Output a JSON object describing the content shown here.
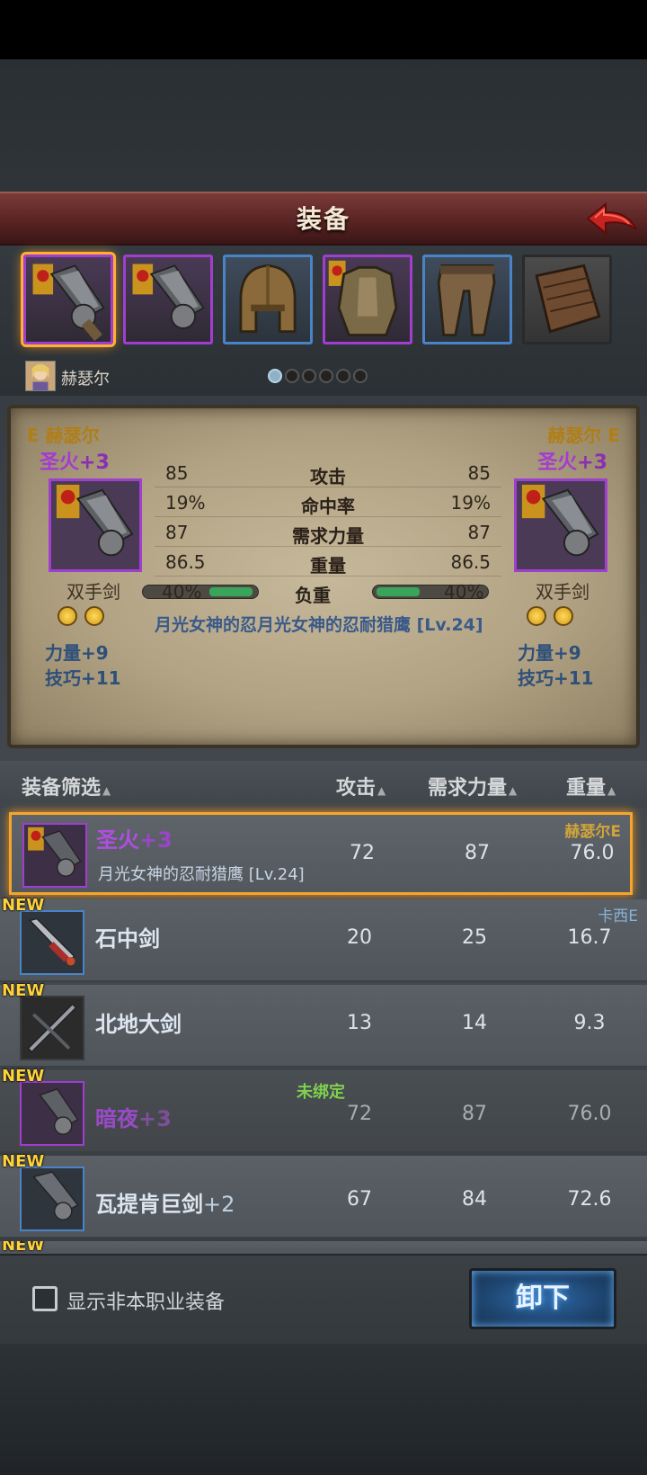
{
  "header": {
    "title": "装备"
  },
  "hero": {
    "name": "赫瑟尔"
  },
  "slots": [
    {
      "icon": "greatsword-icon",
      "rarity": "purple",
      "selected": true
    },
    {
      "icon": "greatsword-icon",
      "rarity": "purple"
    },
    {
      "icon": "helmet-icon",
      "rarity": "blue"
    },
    {
      "icon": "armor-icon",
      "rarity": "purple"
    },
    {
      "icon": "pants-icon",
      "rarity": "blue"
    },
    {
      "icon": "book-icon",
      "rarity": "gray"
    }
  ],
  "compare": {
    "left": {
      "owner": "E 赫瑟尔",
      "name": "圣火",
      "plus": "+3",
      "type": "双手剑",
      "load_pct": "40%",
      "load_fraction": 0.4,
      "bonuses": [
        "力量+9",
        "技巧+11"
      ]
    },
    "right": {
      "owner": "赫瑟尔 E",
      "name": "圣火",
      "plus": "+3",
      "type": "双手剑",
      "load_pct": "40%",
      "load_fraction": 0.4,
      "bonuses": [
        "力量+9",
        "技巧+11"
      ]
    },
    "stats": [
      {
        "label": "攻击",
        "left": "85",
        "right": "85"
      },
      {
        "label": "命中率",
        "left": "19%",
        "right": "19%"
      },
      {
        "label": "需求力量",
        "left": "87",
        "right": "87"
      },
      {
        "label": "重量",
        "left": "86.5",
        "right": "86.5"
      }
    ],
    "load_label": "负重",
    "skill": "月光女神的忍月光女神的忍耐猎鹰 [Lv.24]"
  },
  "list": {
    "columns": [
      "装备筛选",
      "攻击",
      "需求力量",
      "重量"
    ],
    "rows": [
      {
        "name": "圣火",
        "plus": "+3",
        "sub": "月光女神的忍耐猎鹰 [Lv.24]",
        "atk": "72",
        "str": "87",
        "weight": "76.0",
        "owner": "赫瑟尔E",
        "new": "",
        "selected": true
      },
      {
        "name": "石中剑",
        "plus": "",
        "sub": "",
        "atk": "20",
        "str": "25",
        "weight": "16.7",
        "owner": "卡西E",
        "new": "NEW"
      },
      {
        "name": "北地大剑",
        "plus": "",
        "sub": "",
        "atk": "13",
        "str": "14",
        "weight": "9.3",
        "owner": "",
        "new": "NEW"
      },
      {
        "name": "暗夜",
        "plus": "+3",
        "sub": "",
        "atk": "72",
        "str": "87",
        "weight": "76.0",
        "owner": "",
        "new": "NEW",
        "status": "未绑定"
      },
      {
        "name": "瓦提肯巨剑",
        "plus": "+2",
        "sub": "",
        "atk": "67",
        "str": "84",
        "weight": "72.6",
        "owner": "",
        "new": "NEW"
      },
      {
        "name": "",
        "new": "NEW"
      }
    ]
  },
  "footer": {
    "checkbox_label": "显示非本职业装备",
    "unequip_label": "卸下"
  }
}
